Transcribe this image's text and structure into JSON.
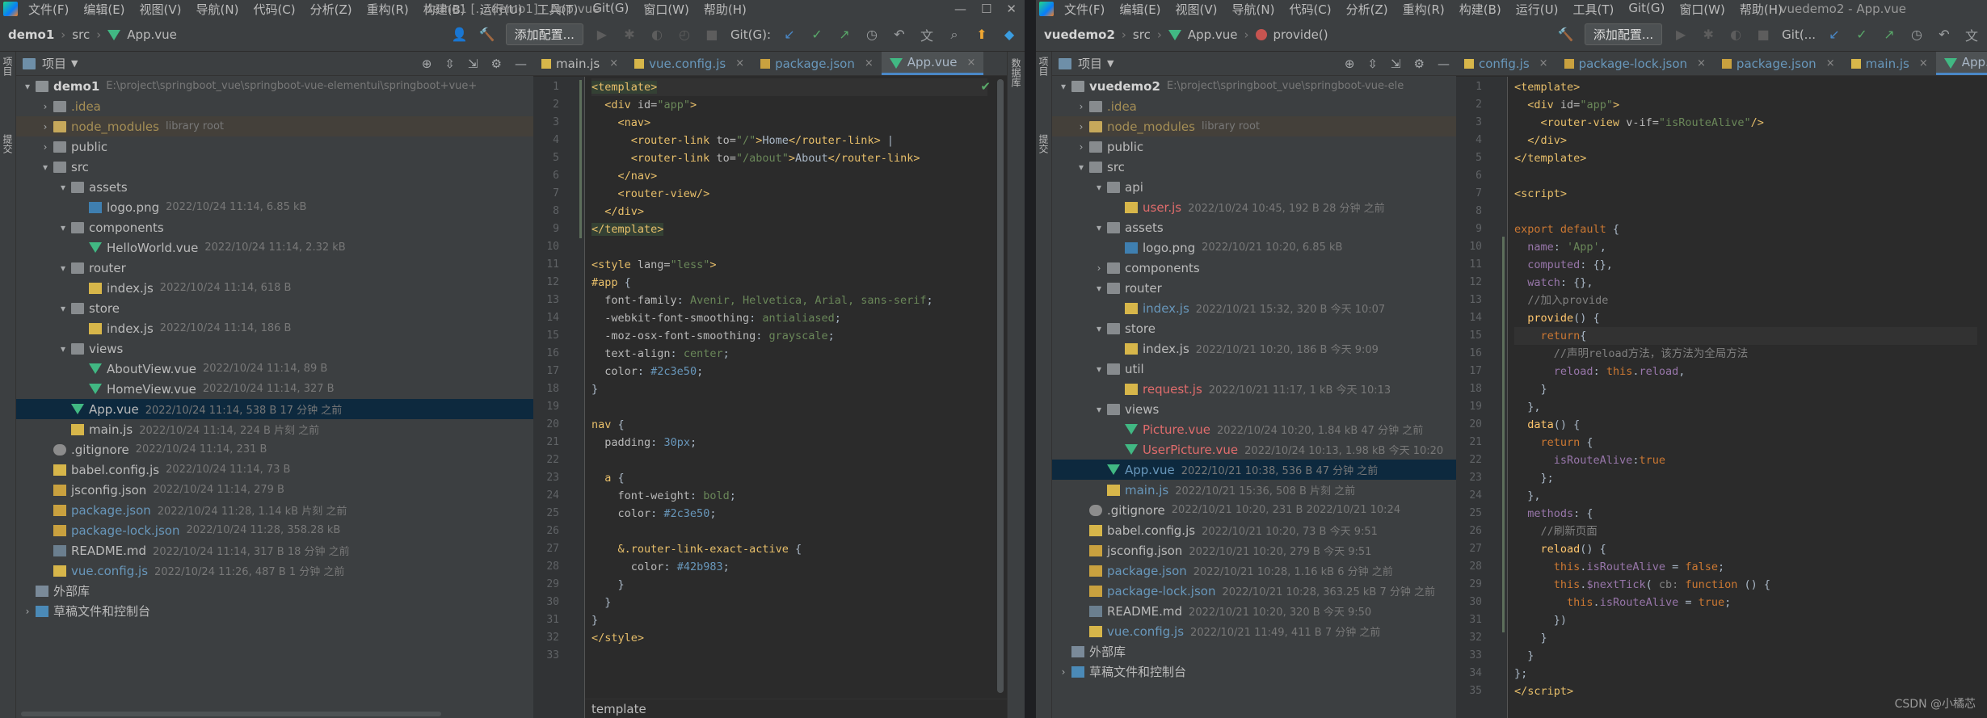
{
  "left": {
    "menu": [
      "文件(F)",
      "编辑(E)",
      "视图(V)",
      "导航(N)",
      "代码(C)",
      "分析(Z)",
      "重构(R)",
      "构建(B)",
      "运行(U)",
      "工具(T)",
      "Git(G)",
      "窗口(W)",
      "帮助(H)"
    ],
    "window_title": "demo1 [...\\demo1] - App.vue",
    "breadcrumb": {
      "project": "demo1",
      "folder": "src",
      "file": "App.vue"
    },
    "config_button": "添加配置...",
    "git_label": "Git(G):",
    "panel_title": "项目",
    "tree": [
      {
        "arrow": "▾",
        "icon": "folder root",
        "name": "demo1",
        "cls": "bold",
        "meta": "E:\\project\\springboot_vue\\springboot-vue-elementui\\springboot+vue+",
        "indent": 0
      },
      {
        "arrow": "›",
        "icon": "folder",
        "name": ".idea",
        "cls": "lib",
        "meta": "",
        "indent": 1
      },
      {
        "arrow": "›",
        "icon": "folder yel",
        "name": "node_modules",
        "cls": "lib",
        "meta": "library root",
        "indent": 1,
        "row": "nm"
      },
      {
        "arrow": "›",
        "icon": "folder",
        "name": "public",
        "cls": "",
        "meta": "",
        "indent": 1
      },
      {
        "arrow": "▾",
        "icon": "folder",
        "name": "src",
        "cls": "",
        "meta": "",
        "indent": 1
      },
      {
        "arrow": "▾",
        "icon": "folder",
        "name": "assets",
        "cls": "",
        "meta": "",
        "indent": 2
      },
      {
        "arrow": "",
        "icon": "fimg",
        "name": "logo.png",
        "cls": "",
        "meta": "2022/10/24 11:14, 6.85 kB",
        "indent": 3
      },
      {
        "arrow": "▾",
        "icon": "folder",
        "name": "components",
        "cls": "",
        "meta": "",
        "indent": 2
      },
      {
        "arrow": "",
        "icon": "fvue",
        "name": "HelloWorld.vue",
        "cls": "",
        "meta": "2022/10/24 11:14, 2.32 kB",
        "indent": 3
      },
      {
        "arrow": "▾",
        "icon": "folder",
        "name": "router",
        "cls": "",
        "meta": "",
        "indent": 2
      },
      {
        "arrow": "",
        "icon": "fjs",
        "name": "index.js",
        "cls": "",
        "meta": "2022/10/24 11:14, 618 B",
        "indent": 3
      },
      {
        "arrow": "▾",
        "icon": "folder",
        "name": "store",
        "cls": "",
        "meta": "",
        "indent": 2
      },
      {
        "arrow": "",
        "icon": "fjs",
        "name": "index.js",
        "cls": "",
        "meta": "2022/10/24 11:14, 186 B",
        "indent": 3
      },
      {
        "arrow": "▾",
        "icon": "folder",
        "name": "views",
        "cls": "",
        "meta": "",
        "indent": 2
      },
      {
        "arrow": "",
        "icon": "fvue",
        "name": "AboutView.vue",
        "cls": "",
        "meta": "2022/10/24 11:14, 89 B",
        "indent": 3
      },
      {
        "arrow": "",
        "icon": "fvue",
        "name": "HomeView.vue",
        "cls": "",
        "meta": "2022/10/24 11:14, 327 B",
        "indent": 3
      },
      {
        "arrow": "",
        "icon": "fvue",
        "name": "App.vue",
        "cls": "",
        "meta": "2022/10/24 11:14, 538 B 17 分钟 之前",
        "indent": 2,
        "row": "sel"
      },
      {
        "arrow": "",
        "icon": "fjs",
        "name": "main.js",
        "cls": "",
        "meta": "2022/10/24 11:14, 224 B 片刻 之前",
        "indent": 2
      },
      {
        "arrow": "",
        "icon": "fgit",
        "name": ".gitignore",
        "cls": "",
        "meta": "2022/10/24 11:14, 231 B",
        "indent": 1
      },
      {
        "arrow": "",
        "icon": "fjs",
        "name": "babel.config.js",
        "cls": "",
        "meta": "2022/10/24 11:14, 73 B",
        "indent": 1
      },
      {
        "arrow": "",
        "icon": "fjson",
        "name": "jsconfig.json",
        "cls": "",
        "meta": "2022/10/24 11:14, 279 B",
        "indent": 1
      },
      {
        "arrow": "",
        "icon": "fjson",
        "name": "package.json",
        "cls": "blue",
        "meta": "2022/10/24 11:28, 1.14 kB 片刻 之前",
        "indent": 1
      },
      {
        "arrow": "",
        "icon": "fjson",
        "name": "package-lock.json",
        "cls": "blue",
        "meta": "2022/10/24 11:28, 358.28 kB",
        "indent": 1
      },
      {
        "arrow": "",
        "icon": "fmd",
        "name": "README.md",
        "cls": "",
        "meta": "2022/10/24 11:14, 317 B 18 分钟 之前",
        "indent": 1
      },
      {
        "arrow": "",
        "icon": "fjs",
        "name": "vue.config.js",
        "cls": "blue",
        "meta": "2022/10/24 11:26, 487 B 1 分钟 之前",
        "indent": 1
      },
      {
        "arrow": "",
        "icon": "flib",
        "name": "外部库",
        "cls": "",
        "meta": "",
        "indent": 0
      },
      {
        "arrow": "›",
        "icon": "fcon",
        "name": "草稿文件和控制台",
        "cls": "",
        "meta": "",
        "indent": 0
      }
    ],
    "tabs": [
      {
        "name": "main.js",
        "kind": "js",
        "active": false
      },
      {
        "name": "vue.config.js",
        "kind": "cfg",
        "active": false
      },
      {
        "name": "package.json",
        "kind": "pkg",
        "active": false
      },
      {
        "name": "App.vue",
        "kind": "vue",
        "active": true
      }
    ],
    "code": [
      "<span class='k-tag k-hl'>&lt;template&gt;</span>",
      "  <span class='k-tag'>&lt;div</span> <span class='k-attr'>id=</span><span class='k-str'>\"app\"</span><span class='k-tag'>&gt;</span>",
      "    <span class='k-tag'>&lt;nav&gt;</span>",
      "      <span class='k-tag'>&lt;router-link</span> <span class='k-attr'>to=</span><span class='k-str'>\"/\"</span><span class='k-tag'>&gt;</span>Home<span class='k-tag'>&lt;/router-link&gt;</span> |",
      "      <span class='k-tag'>&lt;router-link</span> <span class='k-attr'>to=</span><span class='k-str'>\"/about\"</span><span class='k-tag'>&gt;</span>About<span class='k-tag'>&lt;/router-link&gt;</span>",
      "    <span class='k-tag'>&lt;/nav&gt;</span>",
      "    <span class='k-tag'>&lt;router-view/&gt;</span>",
      "  <span class='k-tag'>&lt;/div&gt;</span>",
      "<span class='k-tag k-hl'>&lt;/template&gt;</span>",
      "",
      "<span class='k-tag'>&lt;style</span> <span class='k-attr'>lang=</span><span class='k-str'>\"less\"</span><span class='k-tag'>&gt;</span>",
      "<span class='k-sel'>#app</span> {",
      "  <span class='k-prop'>font-family</span>: <span class='k-val'>Avenir, Helvetica, Arial, sans-serif</span>;",
      "  <span class='k-prop'>-webkit-font-smoothing</span>: <span class='k-val'>antialiased</span>;",
      "  <span class='k-prop'>-moz-osx-font-smoothing</span>: <span class='k-val'>grayscale</span>;",
      "  <span class='k-prop'>text-align</span>: <span class='k-val'>center</span>;",
      "  <span class='k-prop'>color</span>: <span class='k-num'>#2c3e50</span>;",
      "}",
      "",
      "<span class='k-sel'>nav</span> {",
      "  <span class='k-prop'>padding</span>: <span class='k-num'>30px</span>;",
      "",
      "  <span class='k-sel'>a</span> {",
      "    <span class='k-prop'>font-weight</span>: <span class='k-val'>bold</span>;",
      "    <span class='k-prop'>color</span>: <span class='k-num'>#2c3e50</span>;",
      "",
      "    <span class='k-sel'>&amp;.router-link-exact-active</span> {",
      "      <span class='k-prop'>color</span>: <span class='k-num'>#42b983</span>;",
      "    }",
      "  }",
      "}",
      "<span class='k-tag'>&lt;/style&gt;</span>",
      ""
    ],
    "bottom_crumb": "template"
  },
  "right": {
    "menu": [
      "文件(F)",
      "编辑(E)",
      "视图(V)",
      "导航(N)",
      "代码(C)",
      "分析(Z)",
      "重构(R)",
      "构建(B)",
      "运行(U)",
      "工具(T)",
      "Git(G)",
      "窗口(W)",
      "帮助(H)"
    ],
    "window_title": "vuedemo2 - App.vue",
    "breadcrumb": {
      "project": "vuedemo2",
      "folder": "src",
      "file": "App.vue",
      "method": "provide()"
    },
    "config_button": "添加配置...",
    "git_label": "Git(...",
    "panel_title": "项目",
    "tree": [
      {
        "arrow": "▾",
        "icon": "folder root",
        "name": "vuedemo2",
        "cls": "bold",
        "meta": "E:\\project\\springboot_vue\\springboot-vue-ele",
        "indent": 0
      },
      {
        "arrow": "›",
        "icon": "folder",
        "name": ".idea",
        "cls": "lib",
        "meta": "",
        "indent": 1
      },
      {
        "arrow": "›",
        "icon": "folder yel",
        "name": "node_modules",
        "cls": "lib",
        "meta": "library root",
        "indent": 1,
        "row": "nm"
      },
      {
        "arrow": "›",
        "icon": "folder",
        "name": "public",
        "cls": "",
        "meta": "",
        "indent": 1
      },
      {
        "arrow": "▾",
        "icon": "folder",
        "name": "src",
        "cls": "",
        "meta": "",
        "indent": 1
      },
      {
        "arrow": "▾",
        "icon": "folder",
        "name": "api",
        "cls": "",
        "meta": "",
        "indent": 2
      },
      {
        "arrow": "",
        "icon": "fjs",
        "name": "user.js",
        "cls": "red",
        "meta": "2022/10/24 10:45, 192 B 28 分钟 之前",
        "indent": 3
      },
      {
        "arrow": "▾",
        "icon": "folder",
        "name": "assets",
        "cls": "",
        "meta": "",
        "indent": 2
      },
      {
        "arrow": "",
        "icon": "fimg",
        "name": "logo.png",
        "cls": "",
        "meta": "2022/10/21 10:20, 6.85 kB",
        "indent": 3
      },
      {
        "arrow": "›",
        "icon": "folder",
        "name": "components",
        "cls": "",
        "meta": "",
        "indent": 2
      },
      {
        "arrow": "▾",
        "icon": "folder",
        "name": "router",
        "cls": "",
        "meta": "",
        "indent": 2
      },
      {
        "arrow": "",
        "icon": "fjs",
        "name": "index.js",
        "cls": "blue",
        "meta": "2022/10/21 15:32, 320 B 今天 10:07",
        "indent": 3
      },
      {
        "arrow": "▾",
        "icon": "folder",
        "name": "store",
        "cls": "",
        "meta": "",
        "indent": 2
      },
      {
        "arrow": "",
        "icon": "fjs",
        "name": "index.js",
        "cls": "",
        "meta": "2022/10/21 10:20, 186 B 今天 9:09",
        "indent": 3
      },
      {
        "arrow": "▾",
        "icon": "folder",
        "name": "util",
        "cls": "",
        "meta": "",
        "indent": 2
      },
      {
        "arrow": "",
        "icon": "fjs",
        "name": "request.js",
        "cls": "red",
        "meta": "2022/10/21 11:17, 1 kB 今天 10:13",
        "indent": 3
      },
      {
        "arrow": "▾",
        "icon": "folder",
        "name": "views",
        "cls": "",
        "meta": "",
        "indent": 2
      },
      {
        "arrow": "",
        "icon": "fvue",
        "name": "Picture.vue",
        "cls": "red",
        "meta": "2022/10/24 10:20, 1.84 kB 47 分钟 之前",
        "indent": 3
      },
      {
        "arrow": "",
        "icon": "fvue",
        "name": "UserPicture.vue",
        "cls": "red",
        "meta": "2022/10/24 10:13, 1.98 kB 今天 10:20",
        "indent": 3
      },
      {
        "arrow": "",
        "icon": "fvue",
        "name": "App.vue",
        "cls": "blue",
        "meta": "2022/10/21 10:38, 536 B 47 分钟 之前",
        "indent": 2,
        "row": "sel"
      },
      {
        "arrow": "",
        "icon": "fjs",
        "name": "main.js",
        "cls": "blue",
        "meta": "2022/10/21 15:36, 508 B 片刻 之前",
        "indent": 2
      },
      {
        "arrow": "",
        "icon": "fgit",
        "name": ".gitignore",
        "cls": "",
        "meta": "2022/10/21 10:20, 231 B 2022/10/21 10:24",
        "indent": 1
      },
      {
        "arrow": "",
        "icon": "fjs",
        "name": "babel.config.js",
        "cls": "",
        "meta": "2022/10/21 10:20, 73 B 今天 9:51",
        "indent": 1
      },
      {
        "arrow": "",
        "icon": "fjson",
        "name": "jsconfig.json",
        "cls": "",
        "meta": "2022/10/21 10:20, 279 B 今天 9:51",
        "indent": 1
      },
      {
        "arrow": "",
        "icon": "fjson",
        "name": "package.json",
        "cls": "blue",
        "meta": "2022/10/21 10:28, 1.16 kB 6 分钟 之前",
        "indent": 1
      },
      {
        "arrow": "",
        "icon": "fjson",
        "name": "package-lock.json",
        "cls": "blue",
        "meta": "2022/10/21 10:28, 363.25 kB 7 分钟 之前",
        "indent": 1
      },
      {
        "arrow": "",
        "icon": "fmd",
        "name": "README.md",
        "cls": "",
        "meta": "2022/10/21 10:20, 320 B 今天 9:50",
        "indent": 1
      },
      {
        "arrow": "",
        "icon": "fjs",
        "name": "vue.config.js",
        "cls": "blue",
        "meta": "2022/10/21 11:49, 411 B 7 分钟 之前",
        "indent": 1
      },
      {
        "arrow": "",
        "icon": "flib",
        "name": "外部库",
        "cls": "",
        "meta": "",
        "indent": 0
      },
      {
        "arrow": "›",
        "icon": "fcon",
        "name": "草稿文件和控制台",
        "cls": "",
        "meta": "",
        "indent": 0
      }
    ],
    "tabs": [
      {
        "name": "config.js",
        "kind": "cfg",
        "active": false
      },
      {
        "name": "package-lock.json",
        "kind": "pkg",
        "active": false
      },
      {
        "name": "package.json",
        "kind": "pkg",
        "active": false
      },
      {
        "name": "main.js",
        "kind": "cfg",
        "active": false
      },
      {
        "name": "App.vue",
        "kind": "vue",
        "active": true
      }
    ],
    "code": [
      "<span class='k-tag'>&lt;template&gt;</span>",
      "  <span class='k-tag'>&lt;div</span> <span class='k-attr'>id=</span><span class='k-str'>\"app\"</span><span class='k-tag'>&gt;</span>",
      "    <span class='k-tag'>&lt;router-view</span> <span class='k-attr'>v-if=</span><span class='k-str'>\"isRouteAlive\"</span><span class='k-tag'>/&gt;</span>",
      "  <span class='k-tag'>&lt;/div&gt;</span>",
      "<span class='k-tag'>&lt;/template&gt;</span>",
      "",
      "<span class='k-tag'>&lt;script&gt;</span>",
      "",
      "<span class='k-kw'>export default</span> {",
      "  <span class='k-fld'>name</span>: <span class='k-str'>'App'</span>,",
      "  <span class='k-fld'>computed</span>: {},",
      "  <span class='k-fld'>watch</span>: {},",
      "  <span class='k-cmt'>//加入provide</span>",
      "  <span class='k-fn'>provide</span>() {",
      "    <span class='k-kw'>return</span>{",
      "      <span class='k-cmt'>//声明reload方法，该方法为全局方法</span>",
      "      <span class='k-fld'>reload</span>: <span class='k-kw'>this</span>.<span class='k-fld'>reload</span>,",
      "    }",
      "  },",
      "  <span class='k-fn'>data</span>() {",
      "    <span class='k-kw'>return</span> {",
      "      <span class='k-fld'>isRouteAlive</span>:<span class='k-kw'>true</span>",
      "    };",
      "  },",
      "  <span class='k-fld'>methods</span>: {",
      "    <span class='k-cmt'>//刷新页面</span>",
      "    <span class='k-fn'>reload</span>() {",
      "      <span class='k-kw'>this</span>.<span class='k-fld'>isRouteAlive</span> = <span class='k-kw'>false</span>;",
      "      <span class='k-kw'>this</span>.<span class='k-fld'>$nextTick</span>( <span class='k-cmt'>cb:</span> <span class='k-kw'>function</span> () {",
      "        <span class='k-kw'>this</span>.<span class='k-fld'>isRouteAlive</span> = <span class='k-kw'>true</span>;",
      "      })",
      "    }",
      "  }",
      "};",
      "<span class='k-tag'>&lt;/script&gt;</span>"
    ]
  },
  "left_side_labels": [
    "项目",
    "提交"
  ],
  "right_side_labels": [
    "数据库"
  ],
  "watermark": "CSDN @小橘芯",
  "icons": {
    "folder": "folder-icon",
    "vue": "vue-file-icon",
    "js": "js-file-icon",
    "json": "json-file-icon",
    "run": "run-icon",
    "debug": "debug-icon",
    "stop": "stop-icon",
    "search": "search-icon",
    "settings": "gear-icon",
    "target": "crosshair-icon",
    "expand": "expand-all-icon",
    "collapse": "collapse-all-icon",
    "hide": "minimize-icon",
    "check": "checkmark-icon",
    "history": "history-icon",
    "undo": "rollback-icon",
    "translate": "translate-icon",
    "update": "update-icon",
    "ide": "ide-logo-icon"
  },
  "colors": {
    "selection": "#0d293e",
    "vue": "#41b883",
    "tab_active_underline": "#4a88c7",
    "check": "#59a869"
  }
}
